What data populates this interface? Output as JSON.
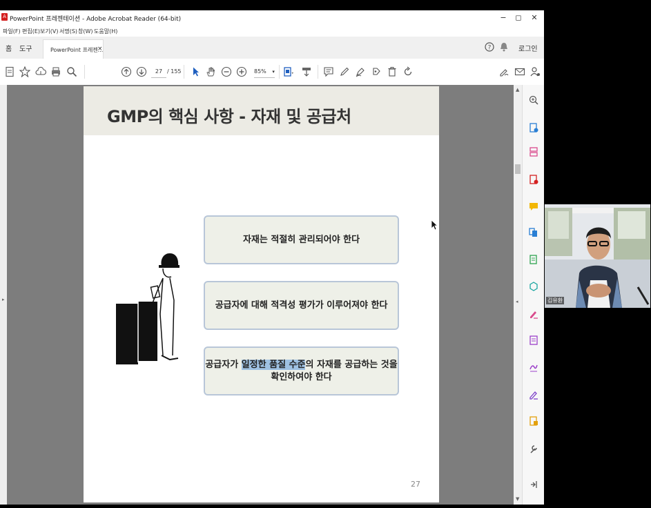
{
  "window": {
    "title": "PowerPoint 프레젠테이션 - Adobe Acrobat Reader (64-bit)",
    "minimize": "−",
    "maximize": "◻",
    "close": "✕"
  },
  "menu": [
    "파일(F)",
    "편집(E)",
    "보기(V)",
    "서명(S)",
    "창(W)",
    "도움말(H)"
  ],
  "tabs": {
    "home": "홈",
    "tools": "도구",
    "doc_tab": "PowerPoint 프레젠...",
    "doc_tab_close": "×",
    "login": "로그인"
  },
  "toolbar": {
    "current_page": "27",
    "total_pages": "/ 155",
    "zoom": "85%"
  },
  "slide": {
    "title": "GMP의 핵심 사항 - 자재 및 공급처",
    "box1": "자재는 적절히 관리되어야 한다",
    "box2": "공급자에 대해 적격성 평가가 이루어져야 한다",
    "box3_pre": "공급자가 ",
    "box3_highlight": "일정한 품질 수준",
    "box3_post": "의 자재를 공급하는 것을",
    "box3_line2": "확인하여야 한다",
    "page_number": "27"
  },
  "webcam": {
    "name": "김유환"
  },
  "colors": {
    "acrobat_red": "#d42020",
    "slide_header_bg": "#ecebe4",
    "box_border": "#b8c6d8",
    "highlight": "#9ec1e2"
  }
}
